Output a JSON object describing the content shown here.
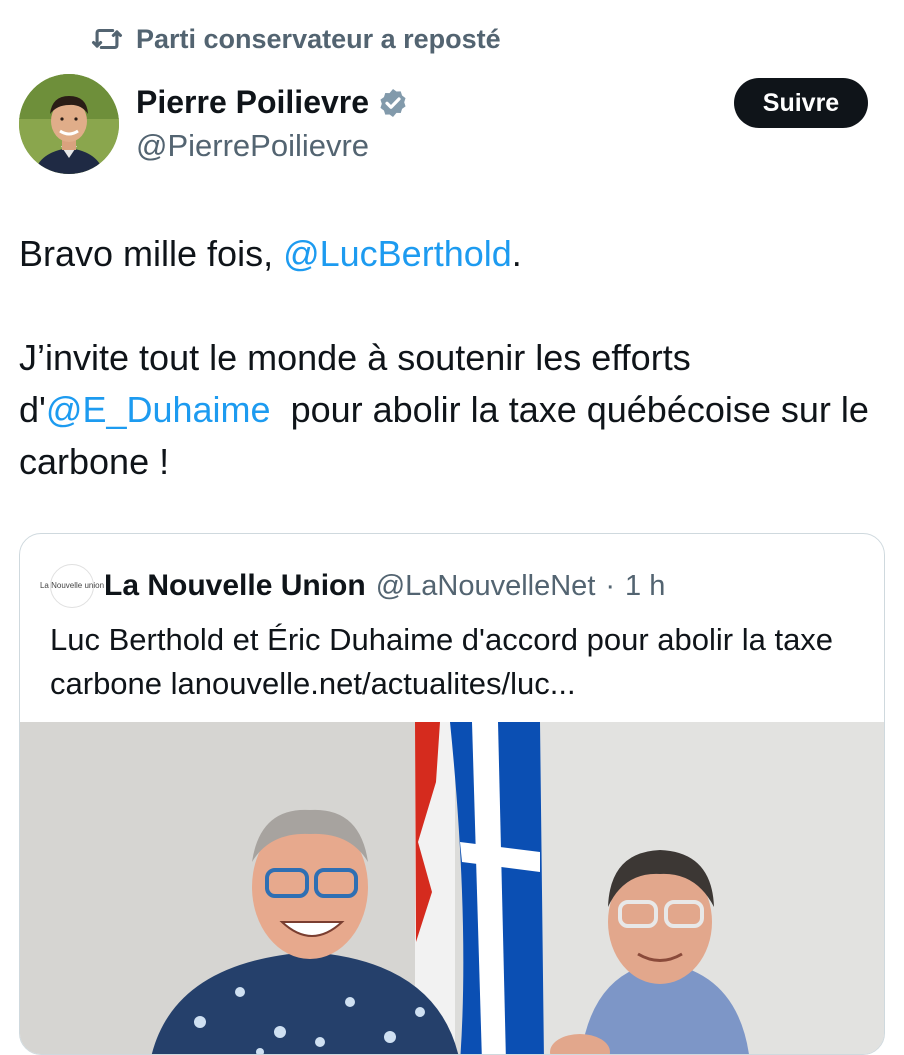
{
  "repost": {
    "icon": "repost-icon",
    "label": "Parti conservateur a reposté"
  },
  "author": {
    "name": "Pierre Poilievre",
    "handle": "@PierrePoilievre",
    "verified": true,
    "verified_color": "#829aab"
  },
  "follow_button": {
    "label": "Suivre"
  },
  "tweet": {
    "line1_before": "Bravo mille fois, ",
    "line1_mention": "@LucBerthold",
    "line1_after": ".",
    "line2_before": "J’invite tout le monde à soutenir les efforts d'",
    "line2_mention": "@E_Duhaime",
    "line2_after": "  pour abolir la taxe québécoise sur le carbone !"
  },
  "quoted": {
    "logo_text": "La Nouvelle union",
    "name": "La Nouvelle Union",
    "handle": "@LaNouvelleNet",
    "separator": "·",
    "time": "1 h",
    "text": "Luc Berthold et Éric Duhaime d'accord pour abolir la taxe carbone lanouvelle.net/actualites/luc..."
  },
  "colors": {
    "link": "#1d9bf0",
    "secondary": "#536471",
    "text": "#0f1419",
    "button_bg": "#0f1419"
  }
}
